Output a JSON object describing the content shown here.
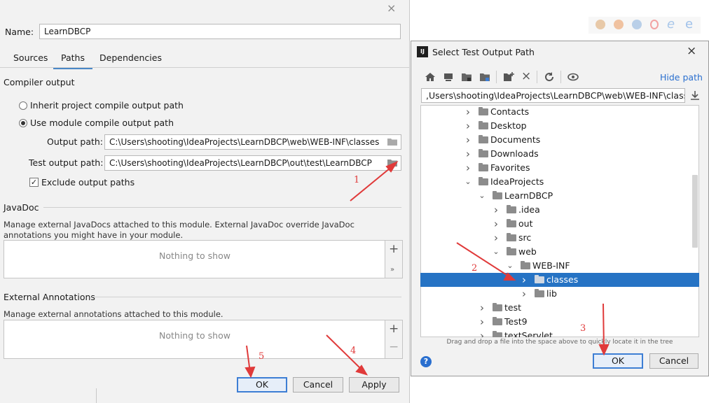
{
  "left_dialog": {
    "name_label": "Name:",
    "name_value": "LearnDBCP",
    "tabs": [
      {
        "label": "Sources"
      },
      {
        "label": "Paths",
        "active": true
      },
      {
        "label": "Dependencies"
      }
    ],
    "compiler_output": {
      "title": "Compiler output",
      "inherit_label": "Inherit project compile output path",
      "use_module_label": "Use module compile output path",
      "selected": "use_module",
      "output_path_label": "Output path:",
      "output_path_value": "C:\\Users\\shooting\\IdeaProjects\\LearnDBCP\\web\\WEB-INF\\classes",
      "test_output_path_label": "Test output path:",
      "test_output_path_value": "C:\\Users\\shooting\\IdeaProjects\\LearnDBCP\\out\\test\\LearnDBCP",
      "exclude_label": "Exclude output paths",
      "exclude_checked": true
    },
    "javadoc": {
      "title": "JavaDoc",
      "description": "Manage external JavaDocs attached to this module. External JavaDoc override JavaDoc annotations you might have in your module.",
      "empty_text": "Nothing to show"
    },
    "external_annotations": {
      "title": "External Annotations",
      "description": "Manage external annotations attached to this module.",
      "empty_text": "Nothing to show"
    },
    "buttons": {
      "ok": "OK",
      "cancel": "Cancel",
      "apply": "Apply"
    }
  },
  "right_dialog": {
    "title": "Select Test Output Path",
    "hide_path": "Hide path",
    "path_value": ",Users\\shooting\\IdeaProjects\\LearnDBCP\\web\\WEB-INF\\classes",
    "tree": [
      {
        "label": "Contacts",
        "depth": 0,
        "expanded": false
      },
      {
        "label": "Desktop",
        "depth": 0,
        "expanded": false
      },
      {
        "label": "Documents",
        "depth": 0,
        "expanded": false
      },
      {
        "label": "Downloads",
        "depth": 0,
        "expanded": false
      },
      {
        "label": "Favorites",
        "depth": 0,
        "expanded": false
      },
      {
        "label": "IdeaProjects",
        "depth": 0,
        "expanded": true
      },
      {
        "label": "LearnDBCP",
        "depth": 1,
        "expanded": true
      },
      {
        "label": ".idea",
        "depth": 2,
        "expanded": false
      },
      {
        "label": "out",
        "depth": 2,
        "expanded": false
      },
      {
        "label": "src",
        "depth": 2,
        "expanded": false
      },
      {
        "label": "web",
        "depth": 2,
        "expanded": true
      },
      {
        "label": "WEB-INF",
        "depth": 3,
        "expanded": true
      },
      {
        "label": "classes",
        "depth": 4,
        "expanded": false,
        "selected": true
      },
      {
        "label": "lib",
        "depth": 4,
        "expanded": false
      },
      {
        "label": "test",
        "depth": 1,
        "expanded": false
      },
      {
        "label": "Test9",
        "depth": 1,
        "expanded": false
      },
      {
        "label": "textServlet",
        "depth": 1,
        "expanded": false
      }
    ],
    "hint": "Drag and drop a file into the space above to quickly locate it in the tree",
    "buttons": {
      "ok": "OK",
      "cancel": "Cancel"
    }
  },
  "annotations": [
    "1",
    "2",
    "3",
    "4",
    "5"
  ],
  "colors": {
    "accent": "#2673c4",
    "annotation": "#e03a3a"
  }
}
